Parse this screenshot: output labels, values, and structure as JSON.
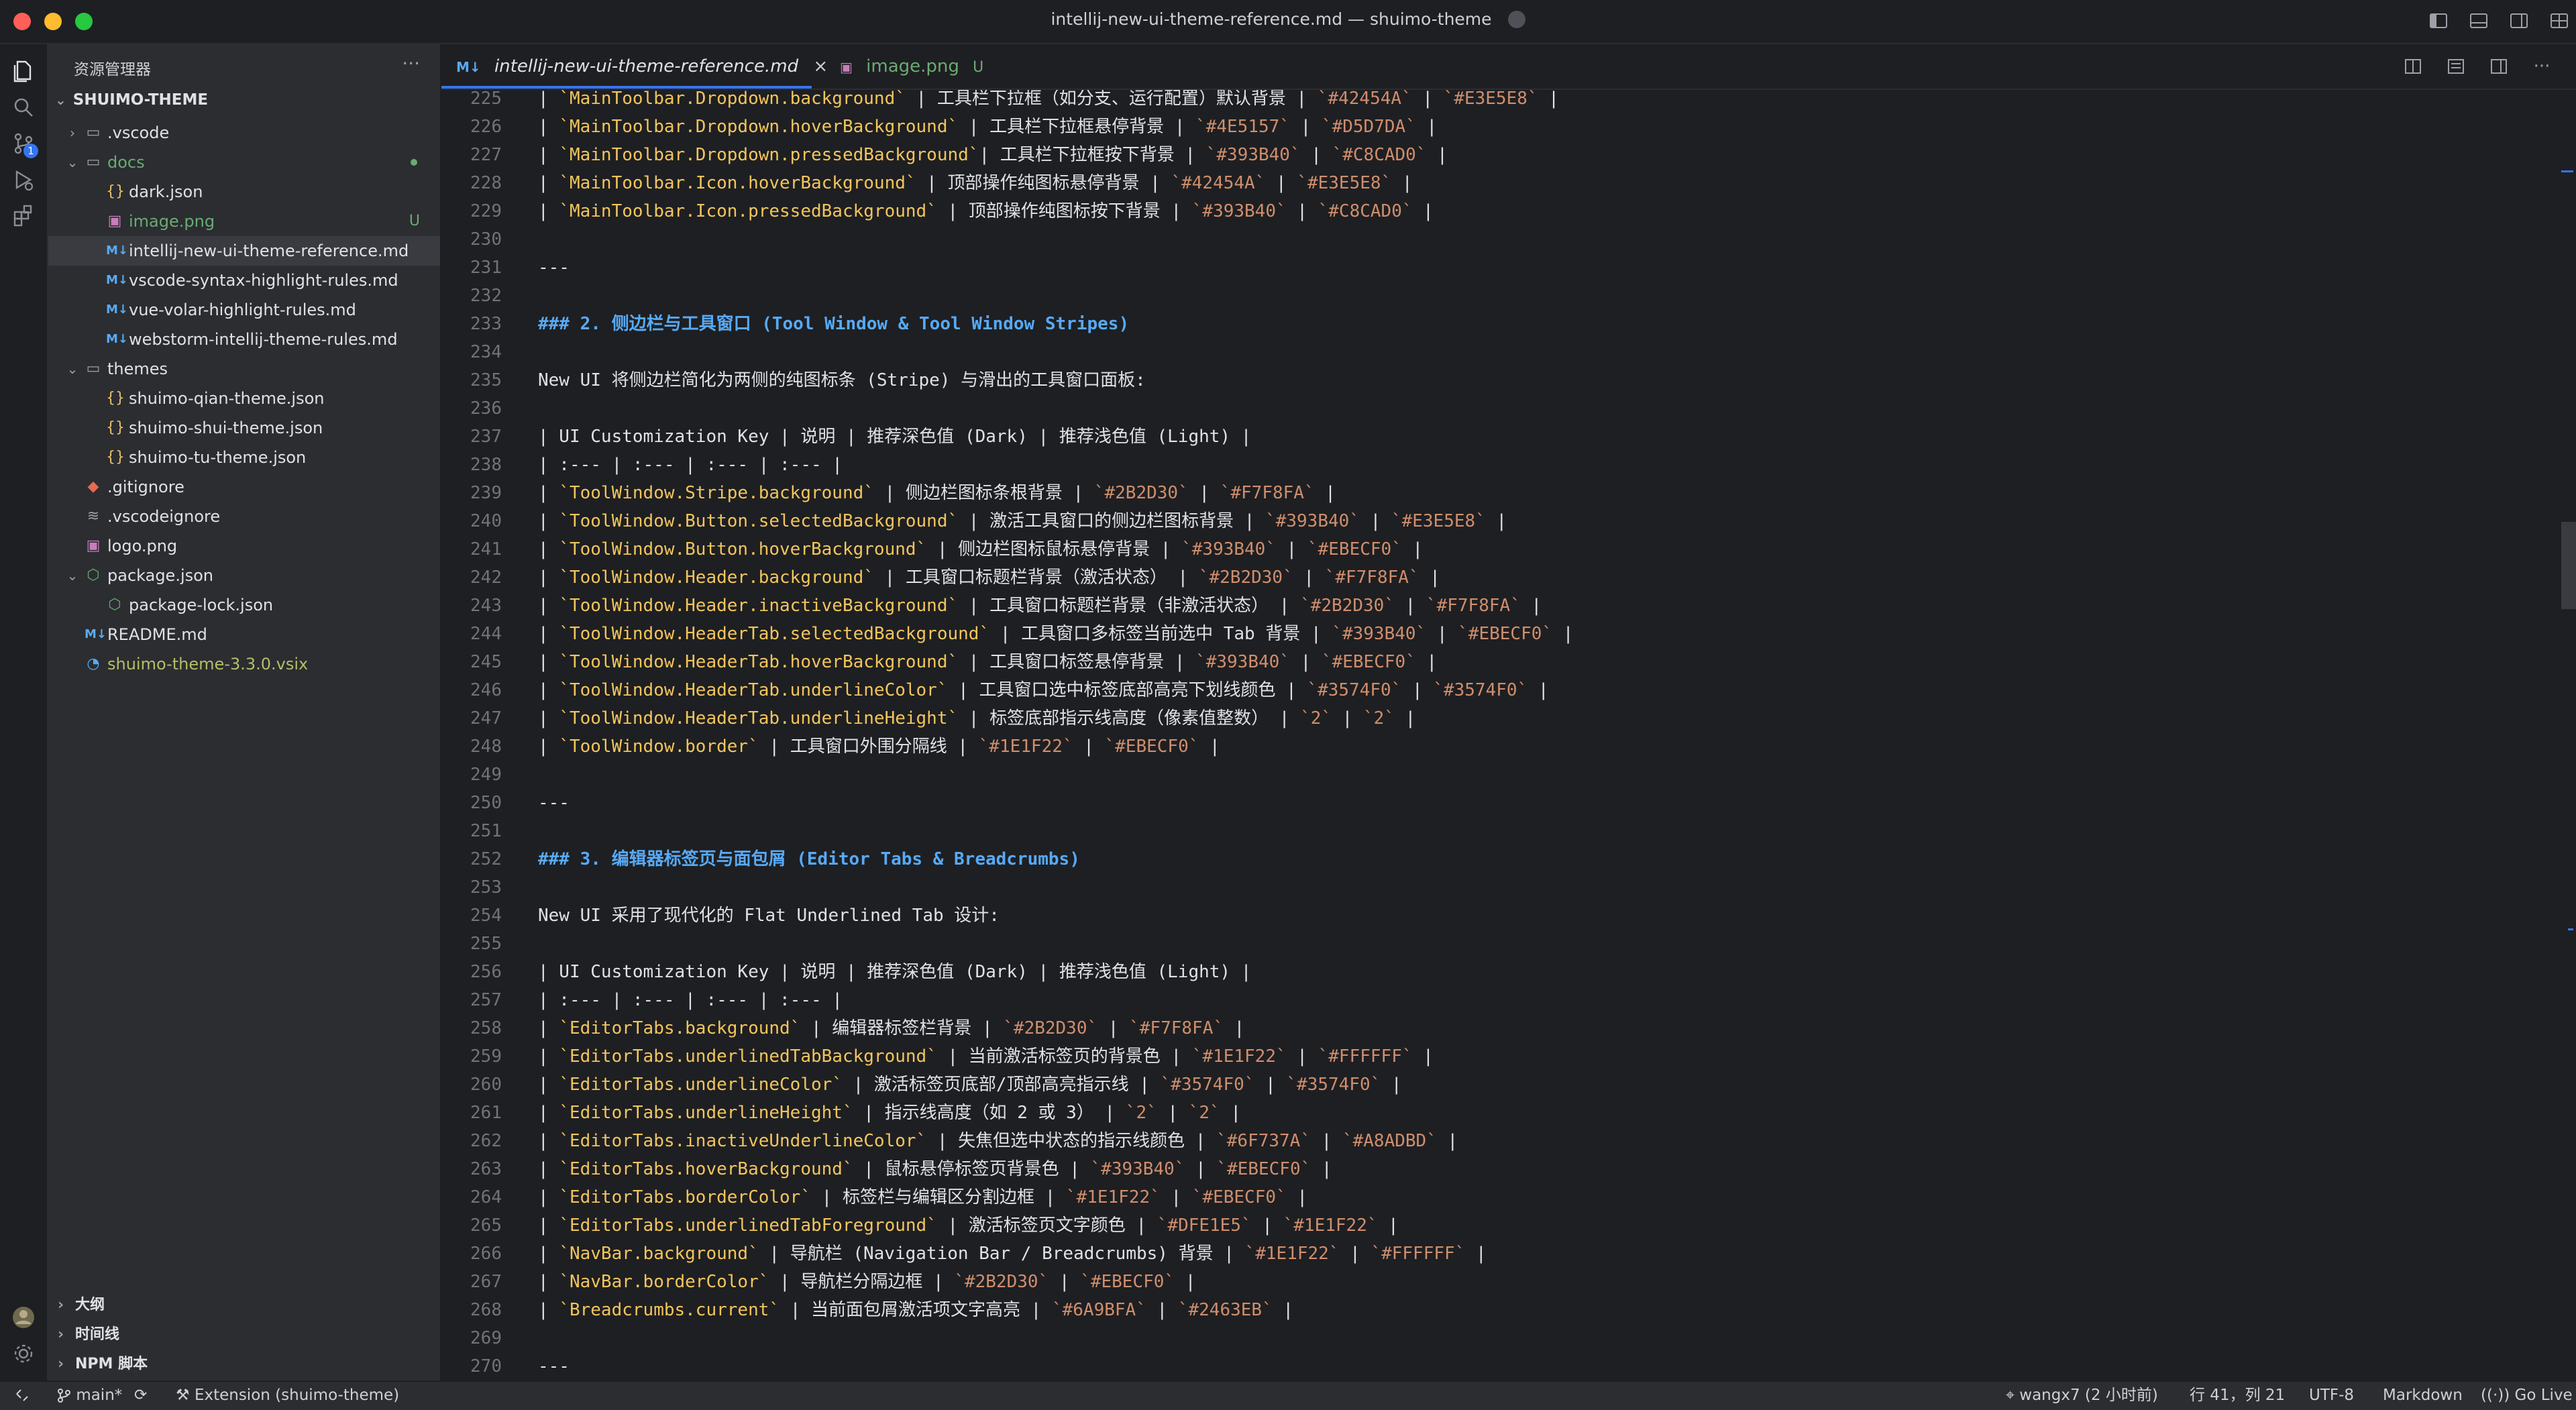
{
  "window": {
    "title": "intellij-new-ui-theme-reference.md — shuimo-theme",
    "traffic_lights": [
      "#FF5F57",
      "#FEBC2E",
      "#28C840"
    ],
    "title_icon": "shield-icon",
    "layout_icons": [
      "toggle-primary-sidebar-icon",
      "toggle-panel-icon",
      "toggle-secondary-sidebar-icon",
      "customize-layout-icon"
    ]
  },
  "activity_bar": {
    "items": [
      {
        "name": "explorer",
        "icon": "files-icon"
      },
      {
        "name": "search",
        "icon": "search-icon"
      },
      {
        "name": "source-control",
        "icon": "git-branch-icon",
        "badge": "1"
      },
      {
        "name": "run-debug",
        "icon": "run-debug-icon"
      },
      {
        "name": "extensions",
        "icon": "extensions-icon"
      }
    ],
    "bottom": [
      {
        "name": "accounts",
        "icon": "avatar-icon"
      },
      {
        "name": "manage",
        "icon": "gear-icon"
      }
    ]
  },
  "sidebar": {
    "title": "资源管理器",
    "more_label": "···",
    "root": "SHUIMO-THEME",
    "tree": [
      {
        "label": ".vscode",
        "type": "folder",
        "depth": 0,
        "open": false
      },
      {
        "label": "docs",
        "type": "folder",
        "depth": 0,
        "open": true,
        "color": "#6AAB73",
        "dot": true
      },
      {
        "label": "dark.json",
        "type": "json",
        "depth": 1
      },
      {
        "label": "image.png",
        "type": "image",
        "depth": 1,
        "color": "#6AAB73",
        "badge": "U"
      },
      {
        "label": "intellij-new-ui-theme-reference.md",
        "type": "md",
        "depth": 1,
        "selected": true
      },
      {
        "label": "vscode-syntax-highlight-rules.md",
        "type": "md",
        "depth": 1
      },
      {
        "label": "vue-volar-highlight-rules.md",
        "type": "md",
        "depth": 1
      },
      {
        "label": "webstorm-intellij-theme-rules.md",
        "type": "md",
        "depth": 1
      },
      {
        "label": "themes",
        "type": "folder",
        "depth": 0,
        "open": true
      },
      {
        "label": "shuimo-qian-theme.json",
        "type": "json",
        "depth": 1
      },
      {
        "label": "shuimo-shui-theme.json",
        "type": "json",
        "depth": 1
      },
      {
        "label": "shuimo-tu-theme.json",
        "type": "json",
        "depth": 1
      },
      {
        "label": ".gitignore",
        "type": "git",
        "depth": 0
      },
      {
        "label": ".vscodeignore",
        "type": "ignore",
        "depth": 0
      },
      {
        "label": "logo.png",
        "type": "image",
        "depth": 0
      },
      {
        "label": "package.json",
        "type": "npm",
        "depth": 0,
        "open": true
      },
      {
        "label": "package-lock.json",
        "type": "npm",
        "depth": 1
      },
      {
        "label": "README.md",
        "type": "md",
        "depth": 0
      },
      {
        "label": "shuimo-theme-3.3.0.vsix",
        "type": "vsix",
        "depth": 0,
        "color": "#B5BD68"
      }
    ],
    "sections": [
      "大纲",
      "时间线",
      "NPM 脚本"
    ]
  },
  "tabs": [
    {
      "label": "intellij-new-ui-theme-reference.md",
      "icon": "M↓",
      "active": true,
      "close": "×"
    },
    {
      "label": "image.png",
      "icon": "▣",
      "active": false,
      "badge": "U",
      "color": "#6AAB73"
    }
  ],
  "editor_actions": [
    "open-changes-icon",
    "open-preview-icon",
    "split-editor-icon",
    "more-actions-icon"
  ],
  "editor": {
    "first_line": 225,
    "lines": [
      [
        "| ",
        "k:`MainToolbar.Dropdown.background`",
        " | 工具栏下拉框（如分支、运行配置）默认背景 | ",
        "c:`#42454A`",
        " | ",
        "c:`#E3E5E8`",
        " |"
      ],
      [
        "| ",
        "k:`MainToolbar.Dropdown.hoverBackground`",
        " | 工具栏下拉框悬停背景 | ",
        "c:`#4E5157`",
        " | ",
        "c:`#D5D7DA`",
        " |"
      ],
      [
        "| ",
        "k:`MainToolbar.Dropdown.pressedBackground`",
        "| 工具栏下拉框按下背景 | ",
        "c:`#393B40`",
        " | ",
        "c:`#C8CAD0`",
        " |"
      ],
      [
        "| ",
        "k:`MainToolbar.Icon.hoverBackground`",
        " | 顶部操作纯图标悬停背景 | ",
        "c:`#42454A`",
        " | ",
        "c:`#E3E5E8`",
        " |"
      ],
      [
        "| ",
        "k:`MainToolbar.Icon.pressedBackground`",
        " | 顶部操作纯图标按下背景 | ",
        "c:`#393B40`",
        " | ",
        "c:`#C8CAD0`",
        " |"
      ],
      [
        ""
      ],
      [
        "---"
      ],
      [
        ""
      ],
      [
        "h:### 2. 侧边栏与工具窗口 (Tool Window & Tool Window Stripes)"
      ],
      [
        ""
      ],
      [
        "New UI 将侧边栏简化为两侧的纯图标条 (Stripe) 与滑出的工具窗口面板:"
      ],
      [
        ""
      ],
      [
        "| UI Customization Key | 说明 | 推荐深色值 (Dark) | 推荐浅色值 (Light) |"
      ],
      [
        "| :--- | :--- | :--- | :--- |"
      ],
      [
        "| ",
        "k:`ToolWindow.Stripe.background`",
        " | 侧边栏图标条根背景 | ",
        "c:`#2B2D30`",
        " | ",
        "c:`#F7F8FA`",
        " |"
      ],
      [
        "| ",
        "k:`ToolWindow.Button.selectedBackground`",
        " | 激活工具窗口的侧边栏图标背景 | ",
        "c:`#393B40`",
        " | ",
        "c:`#E3E5E8`",
        " |"
      ],
      [
        "| ",
        "k:`ToolWindow.Button.hoverBackground`",
        " | 侧边栏图标鼠标悬停背景 | ",
        "c:`#393B40`",
        " | ",
        "c:`#EBECF0`",
        " |"
      ],
      [
        "| ",
        "k:`ToolWindow.Header.background`",
        " | 工具窗口标题栏背景（激活状态） | ",
        "c:`#2B2D30`",
        " | ",
        "c:`#F7F8FA`",
        " |"
      ],
      [
        "| ",
        "k:`ToolWindow.Header.inactiveBackground`",
        " | 工具窗口标题栏背景（非激活状态） | ",
        "c:`#2B2D30`",
        " | ",
        "c:`#F7F8FA`",
        " |"
      ],
      [
        "| ",
        "k:`ToolWindow.HeaderTab.selectedBackground`",
        " | 工具窗口多标签当前选中 Tab 背景 | ",
        "c:`#393B40`",
        " | ",
        "c:`#EBECF0`",
        " |"
      ],
      [
        "| ",
        "k:`ToolWindow.HeaderTab.hoverBackground`",
        " | 工具窗口标签悬停背景 | ",
        "c:`#393B40`",
        " | ",
        "c:`#EBECF0`",
        " |"
      ],
      [
        "| ",
        "k:`ToolWindow.HeaderTab.underlineColor`",
        " | 工具窗口选中标签底部高亮下划线颜色 | ",
        "c:`#3574F0`",
        " | ",
        "c:`#3574F0`",
        " |"
      ],
      [
        "| ",
        "k:`ToolWindow.HeaderTab.underlineHeight`",
        " | 标签底部指示线高度（像素值整数） | ",
        "c:`2`",
        " | ",
        "c:`2`",
        " |"
      ],
      [
        "| ",
        "k:`ToolWindow.border`",
        " | 工具窗口外围分隔线 | ",
        "c:`#1E1F22`",
        " | ",
        "c:`#EBECF0`",
        " |"
      ],
      [
        ""
      ],
      [
        "---"
      ],
      [
        ""
      ],
      [
        "h:### 3. 编辑器标签页与面包屑 (Editor Tabs & Breadcrumbs)"
      ],
      [
        ""
      ],
      [
        "New UI 采用了现代化的 Flat Underlined Tab 设计:"
      ],
      [
        ""
      ],
      [
        "| UI Customization Key | 说明 | 推荐深色值 (Dark) | 推荐浅色值 (Light) |"
      ],
      [
        "| :--- | :--- | :--- | :--- |"
      ],
      [
        "| ",
        "k:`EditorTabs.background`",
        " | 编辑器标签栏背景 | ",
        "c:`#2B2D30`",
        " | ",
        "c:`#F7F8FA`",
        " |"
      ],
      [
        "| ",
        "k:`EditorTabs.underlinedTabBackground`",
        " | 当前激活标签页的背景色 | ",
        "c:`#1E1F22`",
        " | ",
        "c:`#FFFFFF`",
        " |"
      ],
      [
        "| ",
        "k:`EditorTabs.underlineColor`",
        " | 激活标签页底部/顶部高亮指示线 | ",
        "c:`#3574F0`",
        " | ",
        "c:`#3574F0`",
        " |"
      ],
      [
        "| ",
        "k:`EditorTabs.underlineHeight`",
        " | 指示线高度（如 2 或 3） | ",
        "c:`2`",
        " | ",
        "c:`2`",
        " |"
      ],
      [
        "| ",
        "k:`EditorTabs.inactiveUnderlineColor`",
        " | 失焦但选中状态的指示线颜色 | ",
        "c:`#6F737A`",
        " | ",
        "c:`#A8ADBD`",
        " |"
      ],
      [
        "| ",
        "k:`EditorTabs.hoverBackground`",
        " | 鼠标悬停标签页背景色 | ",
        "c:`#393B40`",
        " | ",
        "c:`#EBECF0`",
        " |"
      ],
      [
        "| ",
        "k:`EditorTabs.borderColor`",
        " | 标签栏与编辑区分割边框 | ",
        "c:`#1E1F22`",
        " | ",
        "c:`#EBECF0`",
        " |"
      ],
      [
        "| ",
        "k:`EditorTabs.underlinedTabForeground`",
        " | 激活标签页文字颜色 | ",
        "c:`#DFE1E5`",
        " | ",
        "c:`#1E1F22`",
        " |"
      ],
      [
        "| ",
        "k:`NavBar.background`",
        " | 导航栏 (Navigation Bar / Breadcrumbs) 背景 | ",
        "c:`#1E1F22`",
        " | ",
        "c:`#FFFFFF`",
        " |"
      ],
      [
        "| ",
        "k:`NavBar.borderColor`",
        " | 导航栏分隔边框 | ",
        "c:`#2B2D30`",
        " | ",
        "c:`#EBECF0`",
        " |"
      ],
      [
        "| ",
        "k:`Breadcrumbs.current`",
        " | 当前面包屑激活项文字高亮 | ",
        "c:`#6A9BFA`",
        " | ",
        "c:`#2463EB`",
        " |"
      ],
      [
        ""
      ],
      [
        "---"
      ]
    ]
  },
  "status_bar": {
    "remote_icon": "remote-icon",
    "branch": "main*",
    "sync_icon": "sync-icon",
    "extension": "Extension (shuimo-theme)",
    "blame": "wangx7 (2 小时前)",
    "position": "行 41，列 21",
    "encoding": "UTF-8",
    "language": "Markdown",
    "live": "Go Live"
  },
  "colors": {
    "accent": "#3574F0",
    "heading": "#57AAF7",
    "code_key": "#F2C55C",
    "code_value": "#CF8E6D",
    "untracked": "#6AAB73"
  }
}
